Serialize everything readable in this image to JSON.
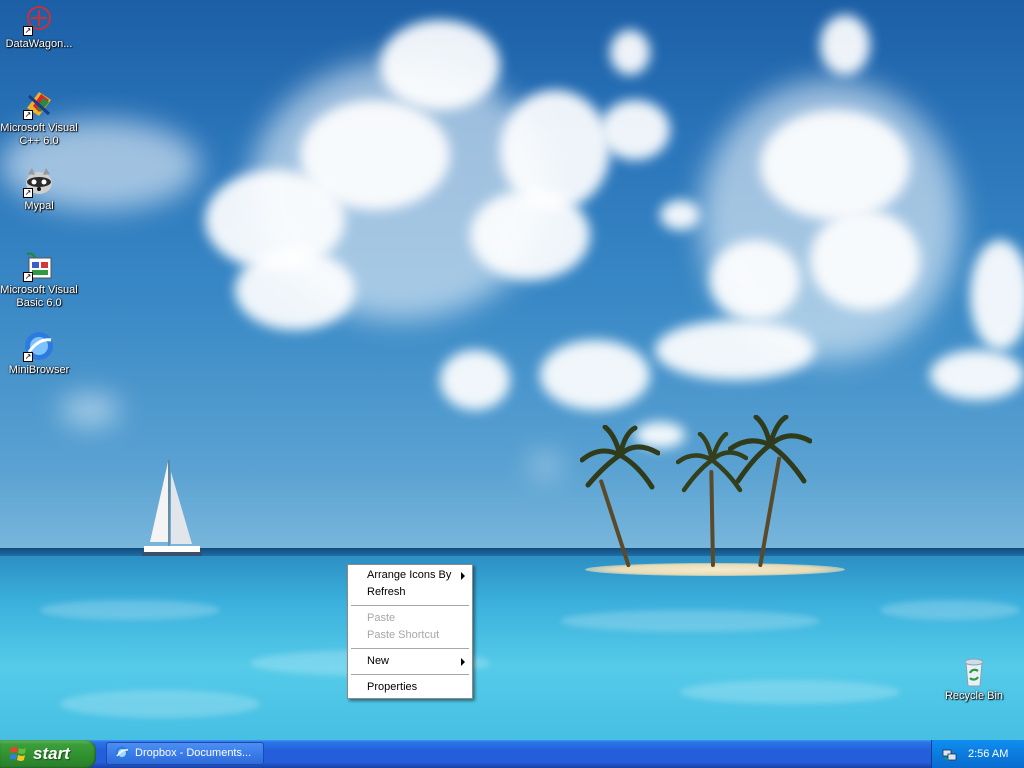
{
  "desktop": {
    "icons": [
      {
        "label": "DataWagon...",
        "icon": "datawagon-icon"
      },
      {
        "label": "Microsoft Visual C++ 6.0",
        "icon": "visual-cpp-icon"
      },
      {
        "label": "Mypal",
        "icon": "mypal-raccoon-icon"
      },
      {
        "label": "Microsoft Visual Basic 6.0",
        "icon": "visual-basic-icon"
      },
      {
        "label": "MiniBrowser",
        "icon": "minibrowser-icon"
      },
      {
        "label": "Recycle Bin",
        "icon": "recycle-bin-icon"
      }
    ]
  },
  "context_menu": {
    "items": [
      {
        "label": "Arrange Icons By",
        "submenu": true,
        "enabled": true
      },
      {
        "label": "Refresh",
        "submenu": false,
        "enabled": true
      },
      {
        "label": "Paste",
        "submenu": false,
        "enabled": false
      },
      {
        "label": "Paste Shortcut",
        "submenu": false,
        "enabled": false
      },
      {
        "label": "New",
        "submenu": true,
        "enabled": true
      },
      {
        "label": "Properties",
        "submenu": false,
        "enabled": true
      }
    ]
  },
  "taskbar": {
    "start_label": "start",
    "task_label": "Dropbox - Documents...",
    "clock": "2:56 AM"
  },
  "colors": {
    "taskbar_blue": "#245edb",
    "start_green": "#3c9e3c",
    "tray_blue": "#0c7fe2",
    "disabled_text": "#a7a6aa"
  }
}
